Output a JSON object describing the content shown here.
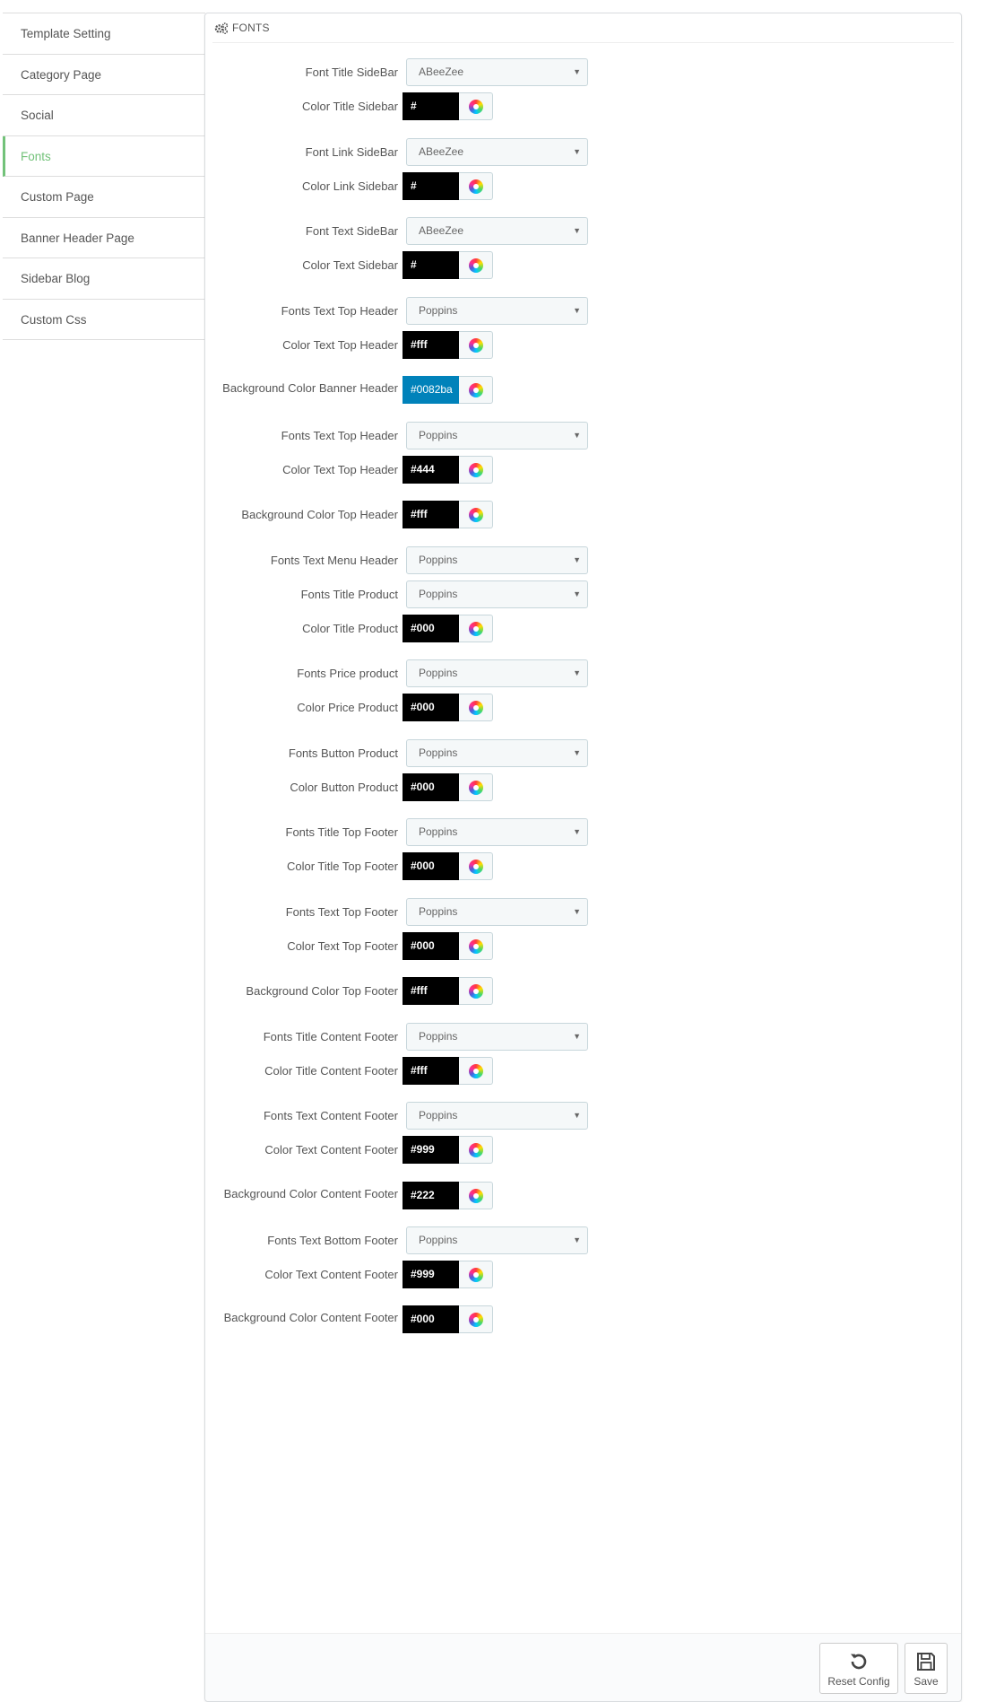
{
  "sidebar": {
    "items": [
      {
        "label": "Template Setting"
      },
      {
        "label": "Category Page"
      },
      {
        "label": "Social"
      },
      {
        "label": "Fonts"
      },
      {
        "label": "Custom Page"
      },
      {
        "label": "Banner Header Page"
      },
      {
        "label": "Sidebar Blog"
      },
      {
        "label": "Custom Css"
      }
    ],
    "active_index": 3
  },
  "panel": {
    "title": "FONTS",
    "fields": [
      {
        "label": "Font Title SideBar",
        "type": "select",
        "value": "ABeeZee"
      },
      {
        "label": "Color Title Sidebar",
        "type": "color",
        "value": "#"
      },
      {
        "label": "Font Link SideBar",
        "type": "select",
        "value": "ABeeZee"
      },
      {
        "label": "Color Link Sidebar",
        "type": "color",
        "value": "#"
      },
      {
        "label": "Font Text SideBar",
        "type": "select",
        "value": "ABeeZee"
      },
      {
        "label": "Color Text Sidebar",
        "type": "color",
        "value": "#"
      },
      {
        "label": "Fonts Text Top Header",
        "type": "select",
        "value": "Poppins"
      },
      {
        "label": "Color Text Top Header",
        "type": "color",
        "value": "#fff"
      },
      {
        "label": "Background Color Banner Header",
        "type": "color",
        "value": "#0082ba",
        "swatch": "#0082ba"
      },
      {
        "label": "Fonts Text Top Header",
        "type": "select",
        "value": "Poppins"
      },
      {
        "label": "Color Text Top Header",
        "type": "color",
        "value": "#444"
      },
      {
        "label": "Background Color Top Header",
        "type": "color",
        "value": "#fff"
      },
      {
        "label": "Fonts Text Menu Header",
        "type": "select",
        "value": "Poppins"
      },
      {
        "label": "Fonts Title Product",
        "type": "select",
        "value": "Poppins"
      },
      {
        "label": "Color Title Product",
        "type": "color",
        "value": "#000"
      },
      {
        "label": "Fonts Price product",
        "type": "select",
        "value": "Poppins"
      },
      {
        "label": "Color Price Product",
        "type": "color",
        "value": "#000"
      },
      {
        "label": "Fonts Button Product",
        "type": "select",
        "value": "Poppins"
      },
      {
        "label": "Color Button Product",
        "type": "color",
        "value": "#000"
      },
      {
        "label": "Fonts Title Top Footer",
        "type": "select",
        "value": "Poppins"
      },
      {
        "label": "Color Title Top Footer",
        "type": "color",
        "value": "#000"
      },
      {
        "label": "Fonts Text Top Footer",
        "type": "select",
        "value": "Poppins"
      },
      {
        "label": "Color Text Top Footer",
        "type": "color",
        "value": "#000"
      },
      {
        "label": "Background Color Top Footer",
        "type": "color",
        "value": "#fff"
      },
      {
        "label": "Fonts Title Content Footer",
        "type": "select",
        "value": "Poppins"
      },
      {
        "label": "Color Title Content Footer",
        "type": "color",
        "value": "#fff"
      },
      {
        "label": "Fonts Text Content Footer",
        "type": "select",
        "value": "Poppins"
      },
      {
        "label": "Color Text Content Footer",
        "type": "color",
        "value": "#999"
      },
      {
        "label": "Background Color Content Footer",
        "type": "color",
        "value": "#222"
      },
      {
        "label": "Fonts Text Bottom Footer",
        "type": "select",
        "value": "Poppins"
      },
      {
        "label": "Color Text Content Footer",
        "type": "color",
        "value": "#999"
      },
      {
        "label": "Background Color Content Footer",
        "type": "color",
        "value": "#000"
      }
    ]
  },
  "footer": {
    "reset_label": "Reset Config",
    "save_label": "Save"
  },
  "colors": {
    "accent": "#72c279",
    "banner_swatch": "#0082ba"
  },
  "icons": {
    "panel_icon": "cogs-icon",
    "picker_icon": "color-wheel-icon",
    "reset_icon": "undo-icon",
    "save_icon": "floppy-disk-icon"
  }
}
